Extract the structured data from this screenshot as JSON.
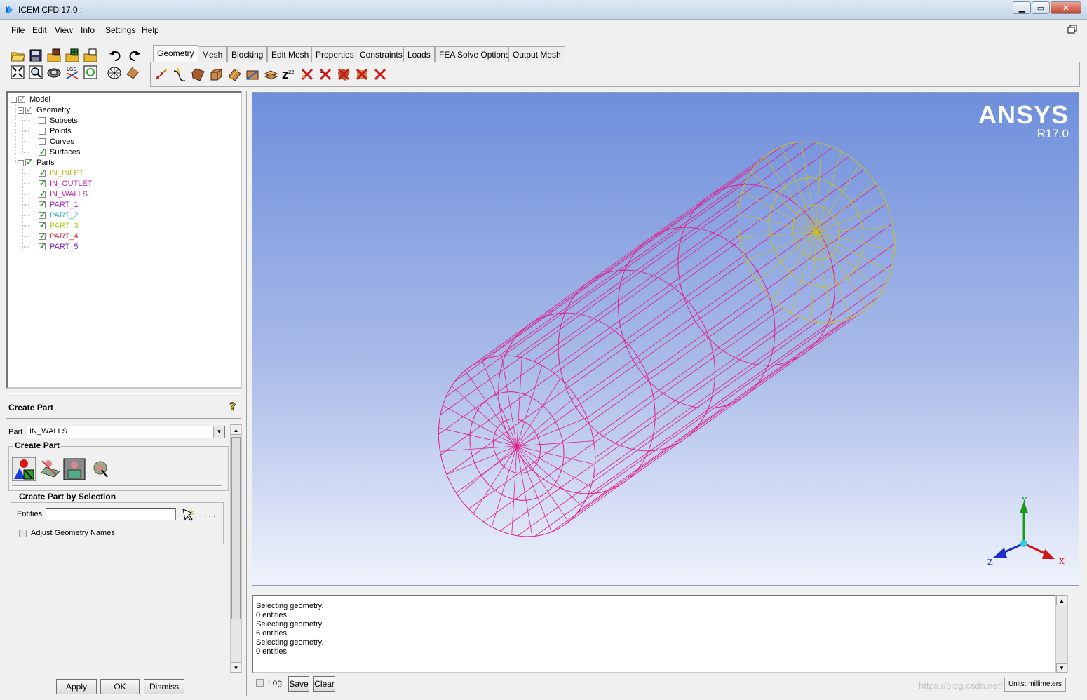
{
  "window": {
    "title": "ICEM CFD 17.0 :"
  },
  "menu": [
    "File",
    "Edit",
    "View",
    "Info",
    "Settings",
    "Help"
  ],
  "tabs": [
    "Geometry",
    "Mesh",
    "Blocking",
    "Edit Mesh",
    "Properties",
    "Constraints",
    "Loads",
    "FEA Solve Options",
    "Output Mesh"
  ],
  "active_tab": "Geometry",
  "tree": {
    "model": "Model",
    "geometry": "Geometry",
    "geometry_children": [
      "Subsets",
      "Points",
      "Curves",
      "Surfaces"
    ],
    "parts": "Parts",
    "parts_children": [
      {
        "name": "IN_INLET",
        "color": "#b8b800"
      },
      {
        "name": "IN_OUTLET",
        "color": "#c020c0"
      },
      {
        "name": "IN_WALLS",
        "color": "#c020a0"
      },
      {
        "name": "PART_1",
        "color": "#a020d0"
      },
      {
        "name": "PART_2",
        "color": "#20b0c0"
      },
      {
        "name": "PART_3",
        "color": "#b0d020"
      },
      {
        "name": "PART_4",
        "color": "#e02040"
      },
      {
        "name": "PART_5",
        "color": "#8020c0"
      }
    ]
  },
  "create_part": {
    "header": "Create Part",
    "part_label": "Part",
    "part_value": "IN_WALLS",
    "group_title": "Create Part",
    "selection_title": "Create Part by Selection",
    "entities_label": "Entities",
    "dots": ". . .",
    "adjust_label": "Adjust Geometry Names",
    "buttons": [
      "Apply",
      "OK",
      "Dismiss"
    ]
  },
  "viewport": {
    "logo": "ANSYS",
    "version": "R17.0",
    "axis_labels": {
      "x": "X",
      "y": "Y",
      "z": "Z"
    },
    "wall_color": "#e0208c",
    "inlet_color": "#c8c020"
  },
  "messages": [
    "Selecting geometry.",
    "0 entities",
    "Selecting geometry.",
    "6 entities",
    "Selecting geometry.",
    "0 entities"
  ],
  "log_bar": {
    "log_label": "Log",
    "save_label": "Save",
    "clear_label": "Clear",
    "units_label": "Units: millimeters"
  },
  "watermark": "https://blog.csdn.net/..."
}
